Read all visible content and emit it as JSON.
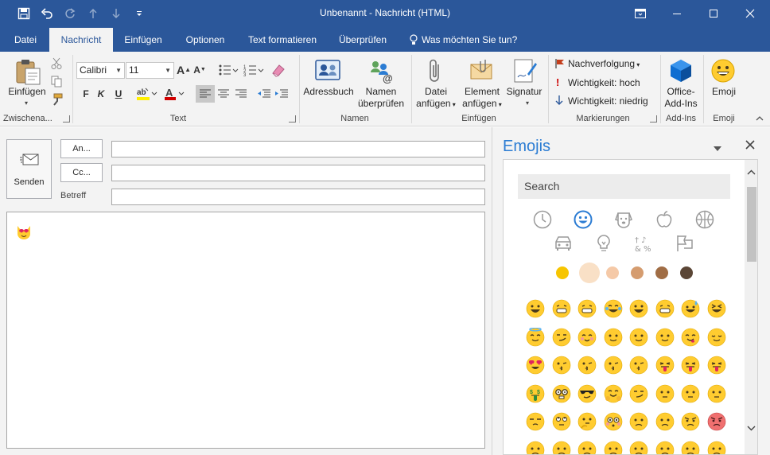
{
  "window": {
    "title": "Unbenannt - Nachricht (HTML)",
    "accent": "#2b579a",
    "quick_access": [
      "save-icon",
      "undo-icon",
      "redo-icon",
      "up-arrow-icon",
      "down-arrow-icon",
      "customize-icon"
    ],
    "controls": [
      "ribbon-display-icon",
      "minimize-icon",
      "maximize-icon",
      "close-icon"
    ]
  },
  "tabs": [
    {
      "label": "Datei",
      "active": false
    },
    {
      "label": "Nachricht",
      "active": true
    },
    {
      "label": "Einfügen",
      "active": false
    },
    {
      "label": "Optionen",
      "active": false
    },
    {
      "label": "Text formatieren",
      "active": false
    },
    {
      "label": "Überprüfen",
      "active": false
    },
    {
      "label": "Was möchten Sie tun?",
      "active": false
    }
  ],
  "ribbon": {
    "clipboard": {
      "group": "Zwischena...",
      "paste": "Einfügen"
    },
    "basic_text": {
      "group": "Text",
      "font": "Calibri",
      "size": "11",
      "bold": "F",
      "italic": "K",
      "underline": "U"
    },
    "names": {
      "group": "Namen",
      "address_book": "Adressbuch",
      "check_names_1": "Namen",
      "check_names_2": "überprüfen"
    },
    "include": {
      "group": "Einfügen",
      "attach_1": "Datei",
      "attach_2": "anfügen",
      "item_1": "Element",
      "item_2": "anfügen",
      "signature": "Signatur"
    },
    "tags": {
      "group": "Markierungen",
      "followup": "Nachverfolgung",
      "high": "Wichtigkeit: hoch",
      "low": "Wichtigkeit: niedrig"
    },
    "addins": {
      "group": "Add-Ins",
      "label_1": "Office-",
      "label_2": "Add-Ins"
    },
    "emoji": {
      "group": "Emoji",
      "label": "Emoji"
    }
  },
  "compose": {
    "send": "Senden",
    "to": "An...",
    "cc": "Cc...",
    "subject": "Betreff",
    "to_value": "",
    "cc_value": "",
    "subject_value": ""
  },
  "pane": {
    "title": "Emojis",
    "search_placeholder": "Search",
    "categories": [
      "recent-icon",
      "smiley-icon",
      "animal-icon",
      "food-icon",
      "sports-icon",
      "vehicle-icon",
      "objects-icon",
      "symbols-icon",
      "flags-icon"
    ],
    "skin_tones": [
      "#f7c500",
      "#f9e0c6",
      "#f5c9a7",
      "#d59c6f",
      "#a06d45",
      "#5b4636"
    ]
  }
}
